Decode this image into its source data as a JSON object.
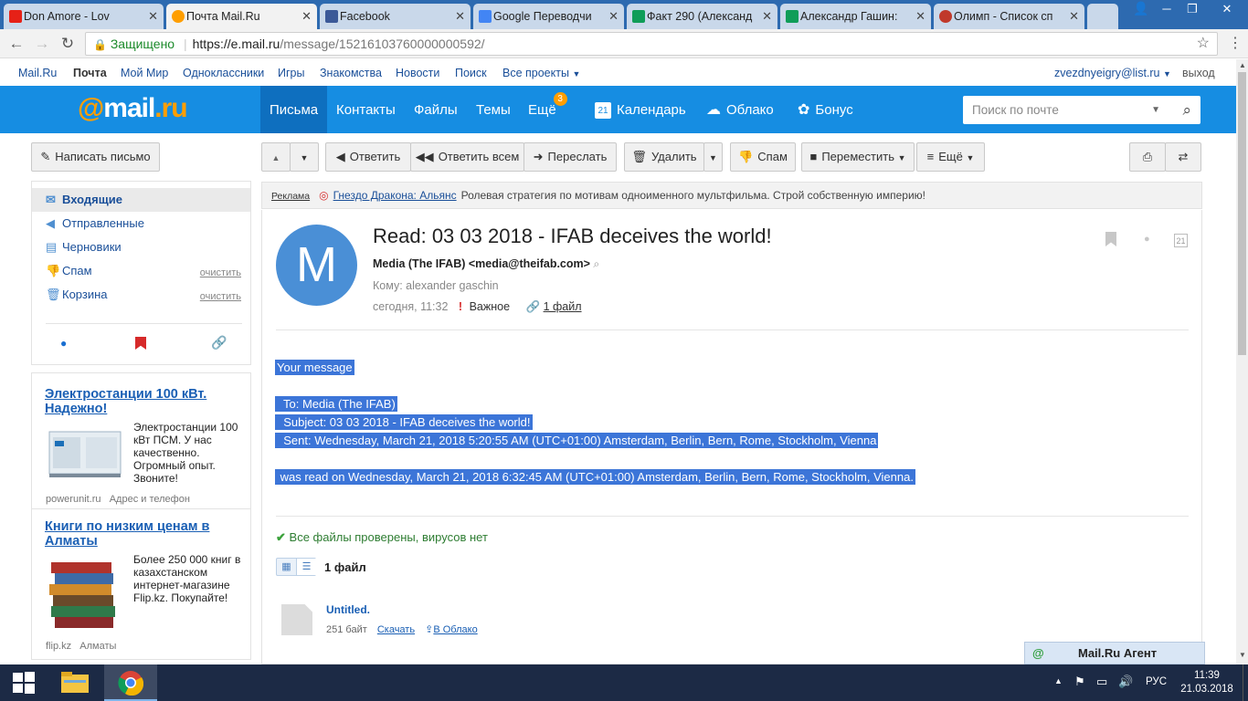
{
  "browser": {
    "tabs": [
      {
        "label": "Don Amore - Lov",
        "color": "#e62117"
      },
      {
        "label": "Почта Mail.Ru",
        "color": "#ff9e00"
      },
      {
        "label": "Facebook",
        "color": "#3b5998"
      },
      {
        "label": "Google Переводчи",
        "color": "#4285f4"
      },
      {
        "label": "Факт 290 (Александ",
        "color": "#0f9d58"
      },
      {
        "label": "Александр Гашин:",
        "color": "#0f9d58"
      },
      {
        "label": "Олимп - Список сп",
        "color": "#c0392b"
      }
    ],
    "secure_label": "Защищено",
    "url_host": "https://e.mail.ru",
    "url_path": "/message/15216103760000000592/"
  },
  "portal": {
    "links": [
      "Mail.Ru",
      "Почта",
      "Мой Мир",
      "Одноклассники",
      "Игры",
      "Знакомства",
      "Новости",
      "Поиск",
      "Все проекты"
    ],
    "user": "zvezdnyeigry@list.ru",
    "logout": "выход"
  },
  "header": {
    "logo_at": "@",
    "logo_mail": "mail",
    "logo_ru": ".ru",
    "tabs": [
      "Письма",
      "Контакты",
      "Файлы",
      "Темы",
      "Ещё"
    ],
    "badge": "3",
    "calendar": "Календарь",
    "cloud": "Облако",
    "bonus": "Бонус",
    "calendar_day": "21",
    "search_placeholder": "Поиск по почте"
  },
  "toolbar": {
    "compose": "Написать письмо",
    "reply": "Ответить",
    "reply_all": "Ответить всем",
    "forward": "Переслать",
    "delete": "Удалить",
    "spam": "Спам",
    "move": "Переместить",
    "more": "Ещё"
  },
  "folders": [
    {
      "label": "Входящие",
      "clean": ""
    },
    {
      "label": "Отправленные",
      "clean": ""
    },
    {
      "label": "Черновики",
      "clean": ""
    },
    {
      "label": "Спам",
      "clean": "очистить"
    },
    {
      "label": "Корзина",
      "clean": "очистить"
    }
  ],
  "ads": [
    {
      "title": "Электростанции 100 кВт. Надежно!",
      "text": "Электростанции 100 кВт ПСМ. У нас качественно. Огромный опыт. Звоните!",
      "domain": "powerunit.ru",
      "extra": "Адрес и телефон"
    },
    {
      "title": "Книги по низким ценам в Алматы",
      "text": "Более 250 000 книг в казахстанском интернет-магазине Flip.kz. Покупайте!",
      "domain": "flip.kz",
      "extra": "Алматы"
    }
  ],
  "reklama": {
    "label": "Реклама",
    "link": "Гнездо Дракона: Альянс",
    "text": "Ролевая стратегия по мотивам одноименного мультфильма. Строй собственную империю!"
  },
  "message": {
    "avatar_letter": "M",
    "subject": "Read: 03 03 2018 - IFAB deceives the world!",
    "from": "Media (The IFAB) <media@theifab.com>",
    "to": "Кому: alexander gaschin",
    "date": "сегодня, 11:32",
    "important_mark": "!",
    "important": "Важное",
    "files_link": "1 файл",
    "body": {
      "line1": "Your message",
      "line2": "  To: Media (The IFAB)",
      "line3": "  Subject: 03 03 2018 - IFAB deceives the world!",
      "line4": "  Sent: Wednesday, March 21, 2018 5:20:55 AM (UTC+01:00) Amsterdam, Berlin, Bern, Rome, Stockholm, Vienna",
      "line5": " was read on Wednesday, March 21, 2018 6:32:45 AM (UTC+01:00) Amsterdam, Berlin, Bern, Rome, Stockholm, Vienna."
    },
    "virus_check": "Все файлы проверены, вирусов нет",
    "files_count": "1 файл",
    "attachment": {
      "name": "Untitled.",
      "size": "251 байт",
      "download": "Скачать",
      "cloud": "В Облако"
    }
  },
  "agent": {
    "label": "Mail.Ru Агент"
  },
  "taskbar": {
    "lang": "РУС",
    "time": "11:39",
    "date": "21.03.2018"
  }
}
